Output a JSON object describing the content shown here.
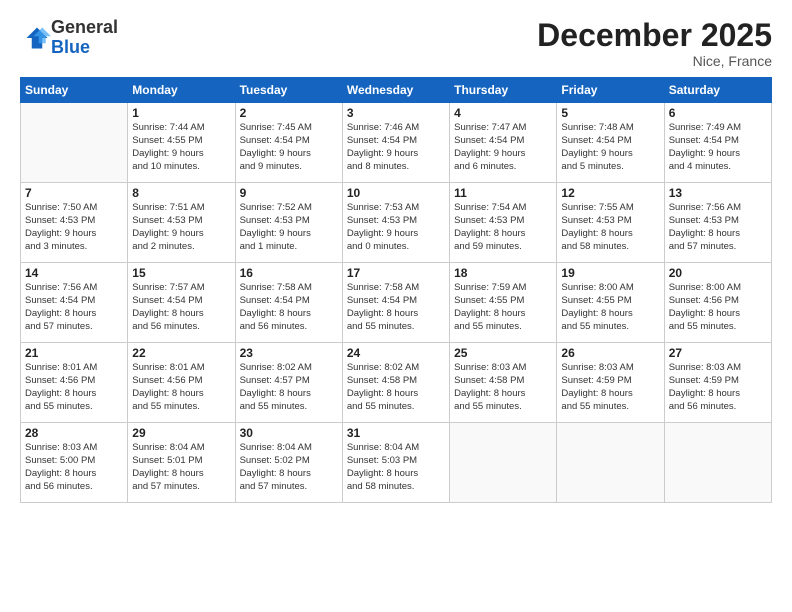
{
  "logo": {
    "line1": "General",
    "line2": "Blue"
  },
  "header": {
    "month": "December 2025",
    "location": "Nice, France"
  },
  "weekdays": [
    "Sunday",
    "Monday",
    "Tuesday",
    "Wednesday",
    "Thursday",
    "Friday",
    "Saturday"
  ],
  "weeks": [
    [
      {
        "day": "",
        "info": ""
      },
      {
        "day": "1",
        "info": "Sunrise: 7:44 AM\nSunset: 4:55 PM\nDaylight: 9 hours\nand 10 minutes."
      },
      {
        "day": "2",
        "info": "Sunrise: 7:45 AM\nSunset: 4:54 PM\nDaylight: 9 hours\nand 9 minutes."
      },
      {
        "day": "3",
        "info": "Sunrise: 7:46 AM\nSunset: 4:54 PM\nDaylight: 9 hours\nand 8 minutes."
      },
      {
        "day": "4",
        "info": "Sunrise: 7:47 AM\nSunset: 4:54 PM\nDaylight: 9 hours\nand 6 minutes."
      },
      {
        "day": "5",
        "info": "Sunrise: 7:48 AM\nSunset: 4:54 PM\nDaylight: 9 hours\nand 5 minutes."
      },
      {
        "day": "6",
        "info": "Sunrise: 7:49 AM\nSunset: 4:54 PM\nDaylight: 9 hours\nand 4 minutes."
      }
    ],
    [
      {
        "day": "7",
        "info": "Sunrise: 7:50 AM\nSunset: 4:53 PM\nDaylight: 9 hours\nand 3 minutes."
      },
      {
        "day": "8",
        "info": "Sunrise: 7:51 AM\nSunset: 4:53 PM\nDaylight: 9 hours\nand 2 minutes."
      },
      {
        "day": "9",
        "info": "Sunrise: 7:52 AM\nSunset: 4:53 PM\nDaylight: 9 hours\nand 1 minute."
      },
      {
        "day": "10",
        "info": "Sunrise: 7:53 AM\nSunset: 4:53 PM\nDaylight: 9 hours\nand 0 minutes."
      },
      {
        "day": "11",
        "info": "Sunrise: 7:54 AM\nSunset: 4:53 PM\nDaylight: 8 hours\nand 59 minutes."
      },
      {
        "day": "12",
        "info": "Sunrise: 7:55 AM\nSunset: 4:53 PM\nDaylight: 8 hours\nand 58 minutes."
      },
      {
        "day": "13",
        "info": "Sunrise: 7:56 AM\nSunset: 4:53 PM\nDaylight: 8 hours\nand 57 minutes."
      }
    ],
    [
      {
        "day": "14",
        "info": "Sunrise: 7:56 AM\nSunset: 4:54 PM\nDaylight: 8 hours\nand 57 minutes."
      },
      {
        "day": "15",
        "info": "Sunrise: 7:57 AM\nSunset: 4:54 PM\nDaylight: 8 hours\nand 56 minutes."
      },
      {
        "day": "16",
        "info": "Sunrise: 7:58 AM\nSunset: 4:54 PM\nDaylight: 8 hours\nand 56 minutes."
      },
      {
        "day": "17",
        "info": "Sunrise: 7:58 AM\nSunset: 4:54 PM\nDaylight: 8 hours\nand 55 minutes."
      },
      {
        "day": "18",
        "info": "Sunrise: 7:59 AM\nSunset: 4:55 PM\nDaylight: 8 hours\nand 55 minutes."
      },
      {
        "day": "19",
        "info": "Sunrise: 8:00 AM\nSunset: 4:55 PM\nDaylight: 8 hours\nand 55 minutes."
      },
      {
        "day": "20",
        "info": "Sunrise: 8:00 AM\nSunset: 4:56 PM\nDaylight: 8 hours\nand 55 minutes."
      }
    ],
    [
      {
        "day": "21",
        "info": "Sunrise: 8:01 AM\nSunset: 4:56 PM\nDaylight: 8 hours\nand 55 minutes."
      },
      {
        "day": "22",
        "info": "Sunrise: 8:01 AM\nSunset: 4:56 PM\nDaylight: 8 hours\nand 55 minutes."
      },
      {
        "day": "23",
        "info": "Sunrise: 8:02 AM\nSunset: 4:57 PM\nDaylight: 8 hours\nand 55 minutes."
      },
      {
        "day": "24",
        "info": "Sunrise: 8:02 AM\nSunset: 4:58 PM\nDaylight: 8 hours\nand 55 minutes."
      },
      {
        "day": "25",
        "info": "Sunrise: 8:03 AM\nSunset: 4:58 PM\nDaylight: 8 hours\nand 55 minutes."
      },
      {
        "day": "26",
        "info": "Sunrise: 8:03 AM\nSunset: 4:59 PM\nDaylight: 8 hours\nand 55 minutes."
      },
      {
        "day": "27",
        "info": "Sunrise: 8:03 AM\nSunset: 4:59 PM\nDaylight: 8 hours\nand 56 minutes."
      }
    ],
    [
      {
        "day": "28",
        "info": "Sunrise: 8:03 AM\nSunset: 5:00 PM\nDaylight: 8 hours\nand 56 minutes."
      },
      {
        "day": "29",
        "info": "Sunrise: 8:04 AM\nSunset: 5:01 PM\nDaylight: 8 hours\nand 57 minutes."
      },
      {
        "day": "30",
        "info": "Sunrise: 8:04 AM\nSunset: 5:02 PM\nDaylight: 8 hours\nand 57 minutes."
      },
      {
        "day": "31",
        "info": "Sunrise: 8:04 AM\nSunset: 5:03 PM\nDaylight: 8 hours\nand 58 minutes."
      },
      {
        "day": "",
        "info": ""
      },
      {
        "day": "",
        "info": ""
      },
      {
        "day": "",
        "info": ""
      }
    ]
  ]
}
